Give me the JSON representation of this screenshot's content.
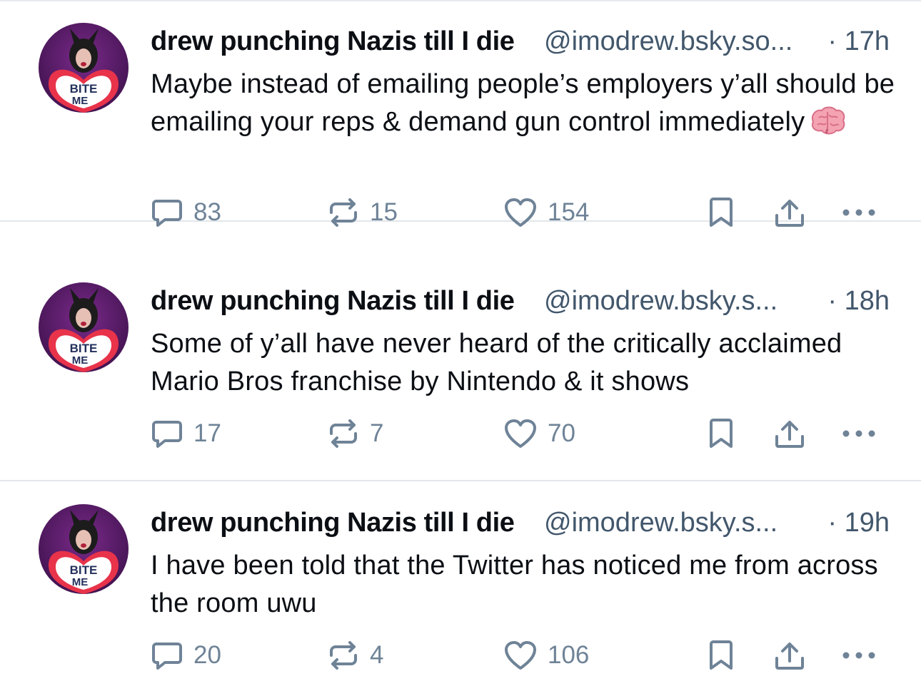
{
  "posts": [
    {
      "author": "drew punching Nazis till I die",
      "handle": "@imodrew.bsky.so...",
      "time": "· 17h",
      "text": "Maybe instead of emailing people’s employers y’all should be emailing your reps & demand gun control immediately",
      "emoji": "brain-emoji",
      "replies": "83",
      "reposts": "15",
      "likes": "154"
    },
    {
      "author": "drew punching Nazis till I die",
      "handle": "@imodrew.bsky.s...",
      "time": "· 18h",
      "text": "Some of y’all have never heard of the critically acclaimed Mario Bros franchise by Nintendo & it shows",
      "replies": "17",
      "reposts": "7",
      "likes": "70"
    },
    {
      "author": "drew punching Nazis till I die",
      "handle": "@imodrew.bsky.s...",
      "time": "· 19h",
      "text": "I have been told that the Twitter has noticed me from across the room uwu",
      "replies": "20",
      "reposts": "4",
      "likes": "106"
    }
  ],
  "avatar_sign_text": [
    "BITE",
    "ME"
  ],
  "colors": {
    "text": "#0b0f14",
    "muted": "#42576c",
    "icon": "#6f8397",
    "divider": "#e3e7eb",
    "avatar_bg": "#5a1f6b",
    "heart_sign": "#e8334a"
  },
  "icons": [
    "reply-icon",
    "repost-icon",
    "like-icon",
    "bookmark-icon",
    "share-icon",
    "more-icon"
  ]
}
